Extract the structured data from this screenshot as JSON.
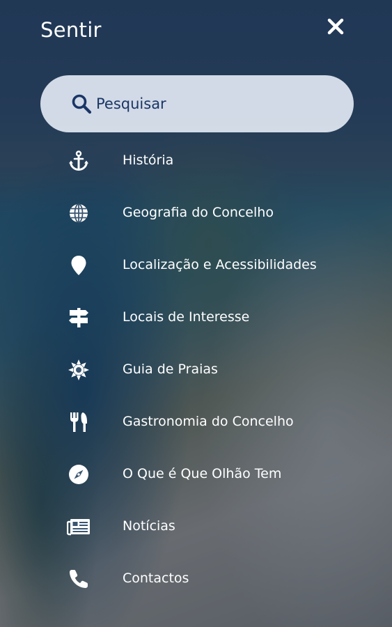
{
  "header": {
    "title": "Sentir",
    "close_icon": "close-icon"
  },
  "search": {
    "icon": "search-icon",
    "placeholder": "Pesquisar"
  },
  "menu": {
    "items": [
      {
        "label": "História",
        "icon": "anchor-icon"
      },
      {
        "label": "Geografia do Concelho",
        "icon": "globe-icon"
      },
      {
        "label": "Localização e Acessibilidades",
        "icon": "map-pin-icon"
      },
      {
        "label": "Locais de Interesse",
        "icon": "signpost-icon"
      },
      {
        "label": "Guia de Praias",
        "icon": "sun-icon"
      },
      {
        "label": "Gastronomia do Concelho",
        "icon": "fork-knife-icon"
      },
      {
        "label": "O Que é Que Olhão Tem",
        "icon": "compass-icon"
      },
      {
        "label": "Notícias",
        "icon": "newspaper-icon"
      },
      {
        "label": "Contactos",
        "icon": "phone-icon"
      }
    ]
  },
  "colors": {
    "text": "#ffffff",
    "search_background": "#e1e8f2",
    "search_text": "#1b3566",
    "overlay": "#0f1e37"
  }
}
